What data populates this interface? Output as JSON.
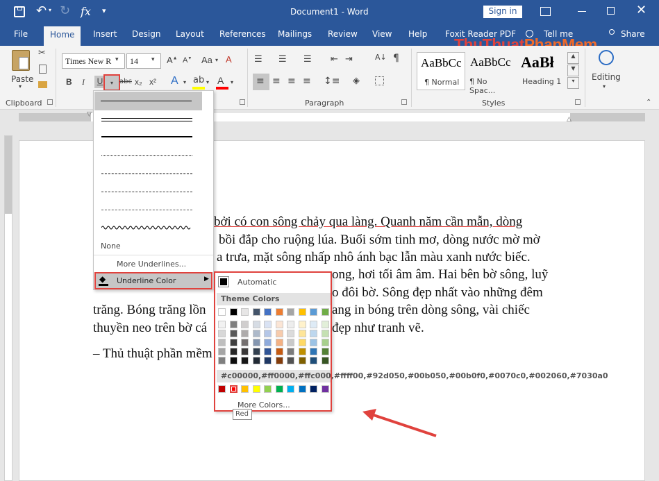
{
  "window": {
    "title": "Document1 - Word",
    "sign_in": "Sign in"
  },
  "tabs": [
    {
      "label": "File"
    },
    {
      "label": "Home"
    },
    {
      "label": "Insert"
    },
    {
      "label": "Design"
    },
    {
      "label": "Layout"
    },
    {
      "label": "References"
    },
    {
      "label": "Mailings"
    },
    {
      "label": "Review"
    },
    {
      "label": "View"
    },
    {
      "label": "Help"
    },
    {
      "label": "Foxit Reader PDF"
    },
    {
      "label": "Tell me"
    },
    {
      "label": "Share"
    }
  ],
  "watermark": {
    "thu": "ThuThuat",
    "phan": "PhanMem",
    ".vn": ".vn"
  },
  "ribbon": {
    "paste": "Paste",
    "clipboard": "Clipboard",
    "font_name": "Times New R",
    "font_size": "14",
    "bold": "B",
    "italic": "I",
    "underline": "U",
    "strike": "abc",
    "subscript": "x₂",
    "superscript": "x²",
    "paragraph": "Paragraph",
    "styles": [
      {
        "preview": "AaBbCc",
        "name": "¶ Normal"
      },
      {
        "preview": "AaBbCc",
        "name": "¶ No Spac..."
      },
      {
        "preview": "AaBł",
        "name": "Heading 1"
      }
    ],
    "styles_label": "Styles",
    "editing": "Editing"
  },
  "document": {
    "lines": [
      "bởi có con sông chảy qua làng. Quanh năm cần mẫn, dòng",
      "bồi đắp cho ruộng lúa. Buổi sớm tinh mơ, dòng nước mờ mờ",
      "a trưa, mặt sông nhấp nhô ánh bạc lẫn màu xanh nước biếc.",
      "ong, hơi tối âm âm. Hai bên bờ sông, luỹ",
      "o đôi bờ. Sông đẹp nhất vào những đêm",
      "trăng. Bóng trăng lồn",
      "ang in bóng trên dòng sông, vài chiếc",
      "thuyền neo trên bờ cá",
      "đẹp như tranh vẽ."
    ],
    "signature": "– Thủ thuật phần mềm"
  },
  "underline_menu": {
    "none": "None",
    "more": "More Underlines...",
    "color": "Underline Color"
  },
  "color_panel": {
    "automatic": "Automatic",
    "theme": "Theme Colors",
    "standard": [
      "#c00000",
      "#ff0000",
      "#ffc000",
      "#ffff00",
      "#92d050",
      "#00b050",
      "#00b0f0",
      "#0070c0",
      "#002060",
      "#7030a0"
    ],
    "more": "More Colors...",
    "tooltip": "Red",
    "theme_top": [
      "#ffffff",
      "#000000",
      "#e7e6e6",
      "#44546a",
      "#4472c4",
      "#ed7d31",
      "#a5a5a5",
      "#ffc000",
      "#5b9bd5",
      "#70ad47"
    ],
    "theme_shades": [
      [
        "#f2f2f2",
        "#7f7f7f",
        "#d0cece",
        "#d6dce4",
        "#d9e2f3",
        "#fbe5d5",
        "#ededed",
        "#fff2cc",
        "#deebf6",
        "#e2efd9"
      ],
      [
        "#d8d8d8",
        "#595959",
        "#aeabab",
        "#adb9ca",
        "#b4c6e7",
        "#f7cbac",
        "#dbdbdb",
        "#fee599",
        "#bdd7ee",
        "#c5e0b3"
      ],
      [
        "#bfbfbf",
        "#3f3f3f",
        "#757070",
        "#8496b0",
        "#8eaadb",
        "#f4b183",
        "#c9c9c9",
        "#ffd965",
        "#9cc3e5",
        "#a8d08d"
      ],
      [
        "#a5a5a5",
        "#262626",
        "#3a3838",
        "#323f4f",
        "#2f5496",
        "#c55a11",
        "#7b7b7b",
        "#bf8f00",
        "#2e75b5",
        "#538135"
      ],
      [
        "#7f7f7f",
        "#0c0c0c",
        "#171616",
        "#222a35",
        "#1f3864",
        "#833c0b",
        "#525252",
        "#7f6000",
        "#1e4e79",
        "#375623"
      ]
    ],
    "highlight": "#e0423d"
  }
}
